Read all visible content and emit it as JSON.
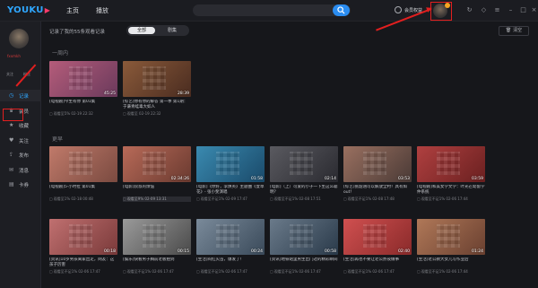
{
  "app": {
    "logo": "YOUKU",
    "nav_home": "主页",
    "nav_channel": "播放"
  },
  "topbar": {
    "member_label": "会员权益",
    "search_placeholder": ""
  },
  "user": {
    "name": "fxxmkh"
  },
  "sidebar": {
    "follow_label": "关注",
    "fans_label": "粉丝",
    "items": [
      {
        "label": "记录",
        "icon": "clock-icon",
        "active": true
      },
      {
        "label": "会员",
        "icon": "crown-icon",
        "active": false
      },
      {
        "label": "收藏",
        "icon": "star-icon",
        "active": false
      },
      {
        "label": "关注",
        "icon": "heart-icon",
        "active": false
      },
      {
        "label": "发布",
        "icon": "upload-icon",
        "active": false
      },
      {
        "label": "消息",
        "icon": "message-icon",
        "active": false
      },
      {
        "label": "卡券",
        "icon": "ticket-icon",
        "active": false
      }
    ]
  },
  "main": {
    "record_count": "记录了我的55条观看记录",
    "filters": [
      "全部",
      "剧集"
    ],
    "clear_label": "清空",
    "sections": [
      {
        "label": "一周内",
        "cards": [
          {
            "title": "[电视剧]今生有你 第01集",
            "duration": "45:25",
            "progress": "观看至5% 02-19 22:32",
            "colors": [
              "#b45c7a",
              "#6b3a5c"
            ]
          },
          {
            "title": "[综艺]你有你的解答 第一季 第1期：于谦青蛙毒大如人",
            "duration": "28:39",
            "progress": "观看至 02-19 22:32",
            "colors": [
              "#8a5a3a",
              "#4a2c20"
            ]
          }
        ]
      },
      {
        "label": "更早",
        "cards": [
          {
            "title": "[电视剧]5·小时拉 第01集",
            "duration": "",
            "progress": "观看至1% 02-18 00:48",
            "colors": [
              "#c07a6a",
              "#7a4a40"
            ]
          },
          {
            "title": "[电影]叔叔的烦恼",
            "duration": "02:34:26",
            "progress": "观看至9% 02-09 13:31",
            "colors": [
              "#b86a58",
              "#6a3a30"
            ],
            "highlight": true
          },
          {
            "title": "[电影]《你好，李焕英》主题曲《萱草花》- 张小斐演唱",
            "duration": "01:58",
            "progress": "观看至不足1% 02-09 17:47",
            "colors": [
              "#3a8ab0",
              "#1a4a6a"
            ]
          },
          {
            "title": "[电影]（上）可爱的小子一下生这么聪明？",
            "duration": "02:14",
            "progress": "观看至不足1% 02-08 17:51",
            "colors": [
              "#5a5a60",
              "#2a2a30"
            ]
          },
          {
            "title": "[综艺]张韶涵可以解放全村！具有如out！",
            "duration": "03:53",
            "progress": "观看至不足1% 02-08 17:48",
            "colors": [
              "#9a7060",
              "#4a3a36"
            ]
          },
          {
            "title": "[电视剧]和美女学文学：叶光芒幼留学仲系统",
            "duration": "03:59",
            "progress": "观看至不足1% 02-06 17:44",
            "colors": [
              "#b04040",
              "#6a2020"
            ]
          },
          {
            "title": "[资讯]10岁男孩离家出走，网友：这孩子厉害",
            "duration": "00:18",
            "progress": "观看至不足1% 02-06 17:47",
            "colors": [
              "#c07070",
              "#7a3a3a"
            ]
          },
          {
            "title": "[娱乐]快看男子胸前老板拍到",
            "duration": "00:15",
            "progress": "观看至不足1% 02-06 17:47",
            "colors": [
              "#9a9a9a",
              "#4a4a4a"
            ]
          },
          {
            "title": "[生活]闷红火苗，爆发了！",
            "duration": "00:24",
            "progress": "观看至不足1% 02-06 17:47",
            "colors": [
              "#7a8a9a",
              "#3a4a5a"
            ]
          },
          {
            "title": "[资讯]地铁站里男生出门过的精彩瞬间",
            "duration": "00:58",
            "progress": "观看至不足1% 02-06 17:47",
            "colors": [
              "#6a7a8a",
              "#2a3a4a"
            ]
          },
          {
            "title": "[生活]再也不要让老公熬夜做事",
            "duration": "02:40",
            "progress": "观看至不足1% 02-06 17:47",
            "colors": [
              "#d05050",
              "#8a2a2a"
            ]
          },
          {
            "title": "[生活]老公教大女儿写作业后",
            "duration": "01:24",
            "progress": "观看至不足1% 02-06 17:44",
            "colors": [
              "#b07858",
              "#6a4030"
            ]
          }
        ]
      }
    ]
  }
}
